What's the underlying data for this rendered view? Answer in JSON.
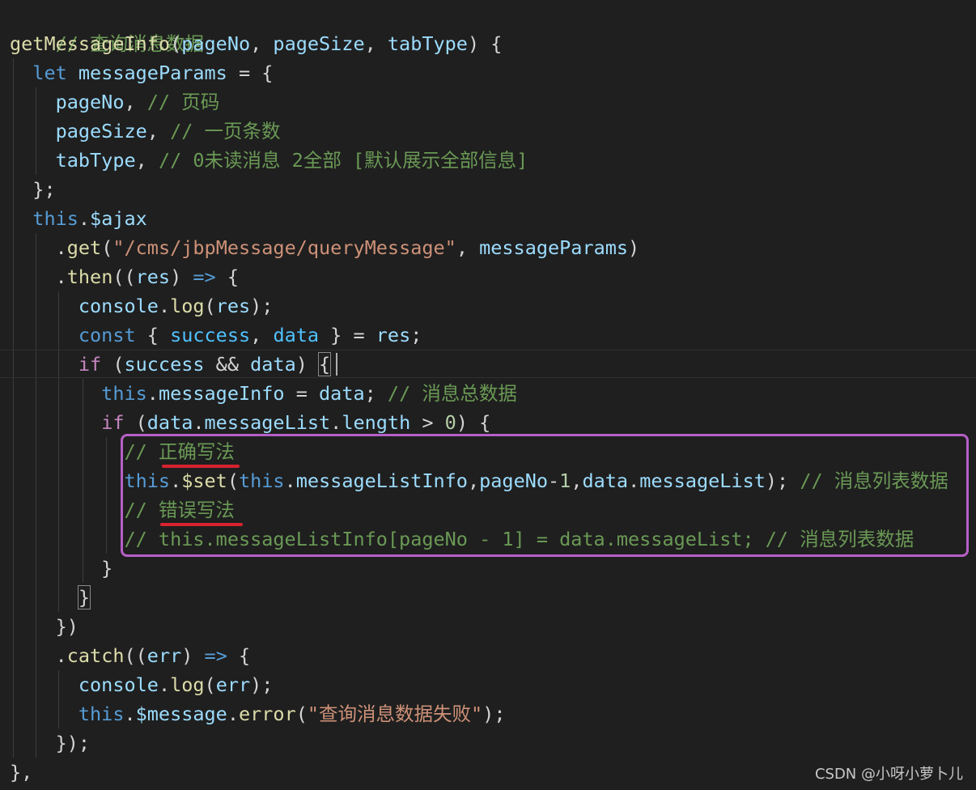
{
  "code": {
    "l1_comment": "// 查询消息数据",
    "l2_fn": "getMessageInfo",
    "l2_p1": "pageNo",
    "l2_p2": "pageSize",
    "l2_p3": "tabType",
    "l3_let": "let",
    "l3_var": "messageParams",
    "l4_key": "pageNo",
    "l4_comment": "// 页码",
    "l5_key": "pageSize",
    "l5_comment": "// 一页条数",
    "l6_key": "tabType",
    "l6_comment": "// 0未读消息 2全部 [默认展示全部信息]",
    "l8_this": "this",
    "l8_ajax": "$ajax",
    "l9_get": "get",
    "l9_str": "\"/cms/jbpMessage/queryMessage\"",
    "l9_arg": "messageParams",
    "l10_then": "then",
    "l10_res": "res",
    "l10_arrow": "=>",
    "l11_console": "console",
    "l11_log": "log",
    "l11_res": "res",
    "l12_const": "const",
    "l12_success": "success",
    "l12_data": "data",
    "l12_res": "res",
    "l13_if": "if",
    "l13_success": "success",
    "l13_data": "data",
    "l14_this": "this",
    "l14_prop": "messageInfo",
    "l14_data": "data",
    "l14_comment": "// 消息总数据",
    "l15_if": "if",
    "l15_data": "data",
    "l15_list": "messageList",
    "l15_len": "length",
    "l15_zero": "0",
    "l16_comment_prefix": "// ",
    "l16_comment_text": "正确写法",
    "l17_this": "this",
    "l17_set": "$set",
    "l17_this2": "this",
    "l17_info": "messageListInfo",
    "l17_pageNo": "pageNo",
    "l17_one": "1",
    "l17_data": "data",
    "l17_list": "messageList",
    "l17_comment": "// 消息列表数据",
    "l18_comment_prefix": "// ",
    "l18_comment_text": "错误写法",
    "l19_comment": "// this.messageListInfo[pageNo - 1] = data.messageList; // 消息列表数据",
    "l23_catch": "catch",
    "l23_err": "err",
    "l23_arrow": "=>",
    "l24_console": "console",
    "l24_log": "log",
    "l24_err": "err",
    "l25_this": "this",
    "l25_msg": "$message",
    "l25_error": "error",
    "l25_str": "\"查询消息数据失败\""
  },
  "watermark": "CSDN @小呀小萝卜儿",
  "colors": {
    "background": "#1f1f1f",
    "comment": "#6a9955",
    "function": "#dcdcaa",
    "variable": "#9cdcfe",
    "keyword": "#569cd6",
    "control": "#c586c0",
    "string": "#ce9178",
    "highlight_box": "#b65fc7",
    "underline": "#d8232f"
  }
}
